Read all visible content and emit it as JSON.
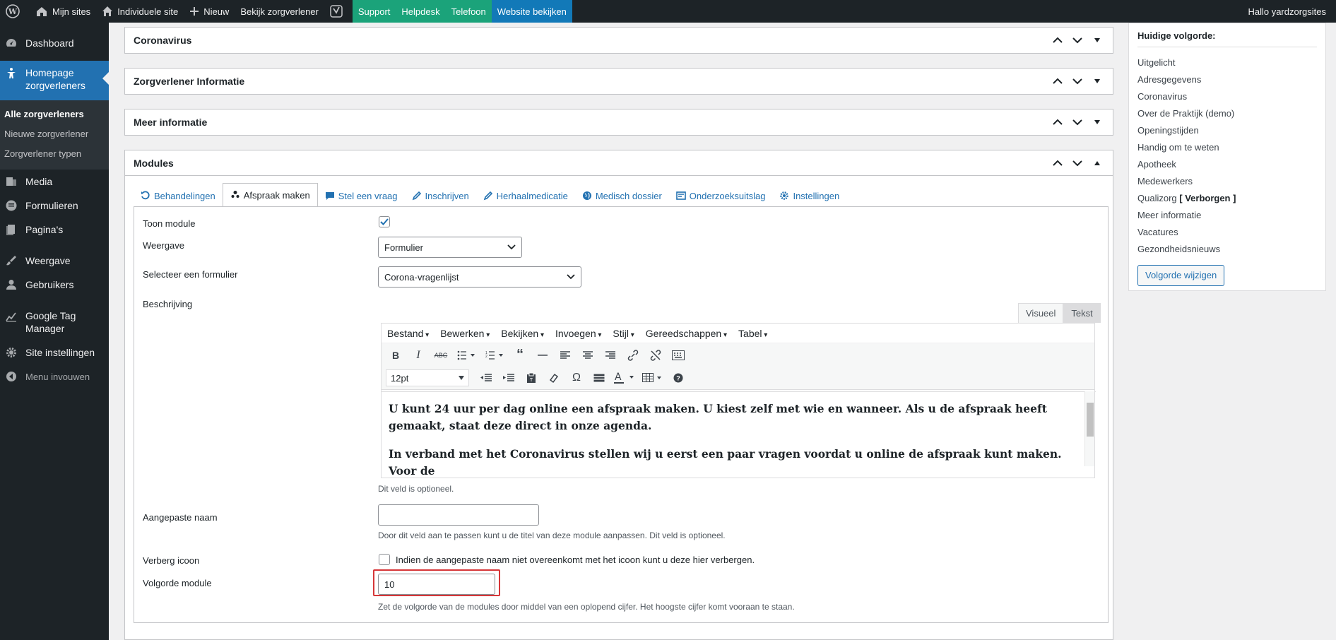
{
  "adminbar": {
    "items": [
      "Mijn sites",
      "Individuele site",
      "Nieuw",
      "Bekijk zorgverlener"
    ],
    "green": [
      "Support",
      "Helpdesk",
      "Telefoon"
    ],
    "blue": "Website bekijken",
    "greeting": "Hallo yardzorgsites"
  },
  "sidebar": {
    "dashboard": "Dashboard",
    "current": "Homepage zorgverleners",
    "submenu": [
      "Alle zorgverleners",
      "Nieuwe zorgverlener",
      "Zorgverlener typen"
    ],
    "items": [
      "Media",
      "Formulieren",
      "Pagina's",
      "Weergave",
      "Gebruikers"
    ],
    "gtm": "Google Tag Manager",
    "site_settings": "Site instellingen",
    "collapse": "Menu invouwen"
  },
  "boxes": {
    "coronavirus": "Coronavirus",
    "info": "Zorgverlener Informatie",
    "meer": "Meer informatie",
    "modules": "Modules"
  },
  "tabs": [
    "Behandelingen",
    "Afspraak maken",
    "Stel een vraag",
    "Inschrijven",
    "Herhaalmedicatie",
    "Medisch dossier",
    "Onderzoeksuitslag",
    "Instellingen"
  ],
  "form": {
    "toon_module": "Toon module",
    "weergave": "Weergave",
    "weergave_value": "Formulier",
    "selecteer": "Selecteer een formulier",
    "selecteer_value": "Corona-vragenlijst",
    "beschrijving": "Beschrijving",
    "editor_tabs": [
      "Visueel",
      "Tekst"
    ],
    "editor_menu": [
      "Bestand",
      "Bewerken",
      "Bekijken",
      "Invoegen",
      "Stijl",
      "Gereedschappen",
      "Tabel"
    ],
    "font_size": "12pt",
    "paragraph1": "U kunt 24 uur per dag online een afspraak maken. U kiest zelf met wie en wanneer. Als u de afspraak heeft gemaakt, staat deze direct in onze agenda.",
    "paragraph2": "In verband met het Coronavirus stellen wij u eerst een paar vragen voordat u online de afspraak kunt maken. Voor de",
    "optional": "Dit veld is optioneel.",
    "aangepaste_naam": "Aangepaste naam",
    "aangepaste_hint": "Door dit veld aan te passen kunt u de titel van deze module aanpassen. Dit veld is optioneel.",
    "verberg_icoon": "Verberg icoon",
    "verberg_hint": "Indien de aangepaste naam niet overeenkomt met het icoon kunt u deze hier verbergen.",
    "volgorde": "Volgorde module",
    "volgorde_value": "10",
    "volgorde_hint": "Zet de volgorde van de modules door middel van een oplopend cijfer. Het hoogste cijfer komt vooraan te staan."
  },
  "order": {
    "title": "Huidige volgorde:",
    "items": [
      "Uitgelicht",
      "Adresgegevens",
      "Coronavirus",
      "Over de Praktijk (demo)",
      "Openingstijden",
      "Handig om te weten",
      "Apotheek",
      "Medewerkers",
      "Qualizorg",
      "Meer informatie",
      "Vacatures",
      "Gezondheidsnieuws"
    ],
    "hidden_tag": "[ Verborgen ]",
    "button": "Volgorde wijzigen"
  },
  "colors": {
    "accent": "#2271b1",
    "adminbar": "#1d2327",
    "highlight": "#d63638"
  }
}
